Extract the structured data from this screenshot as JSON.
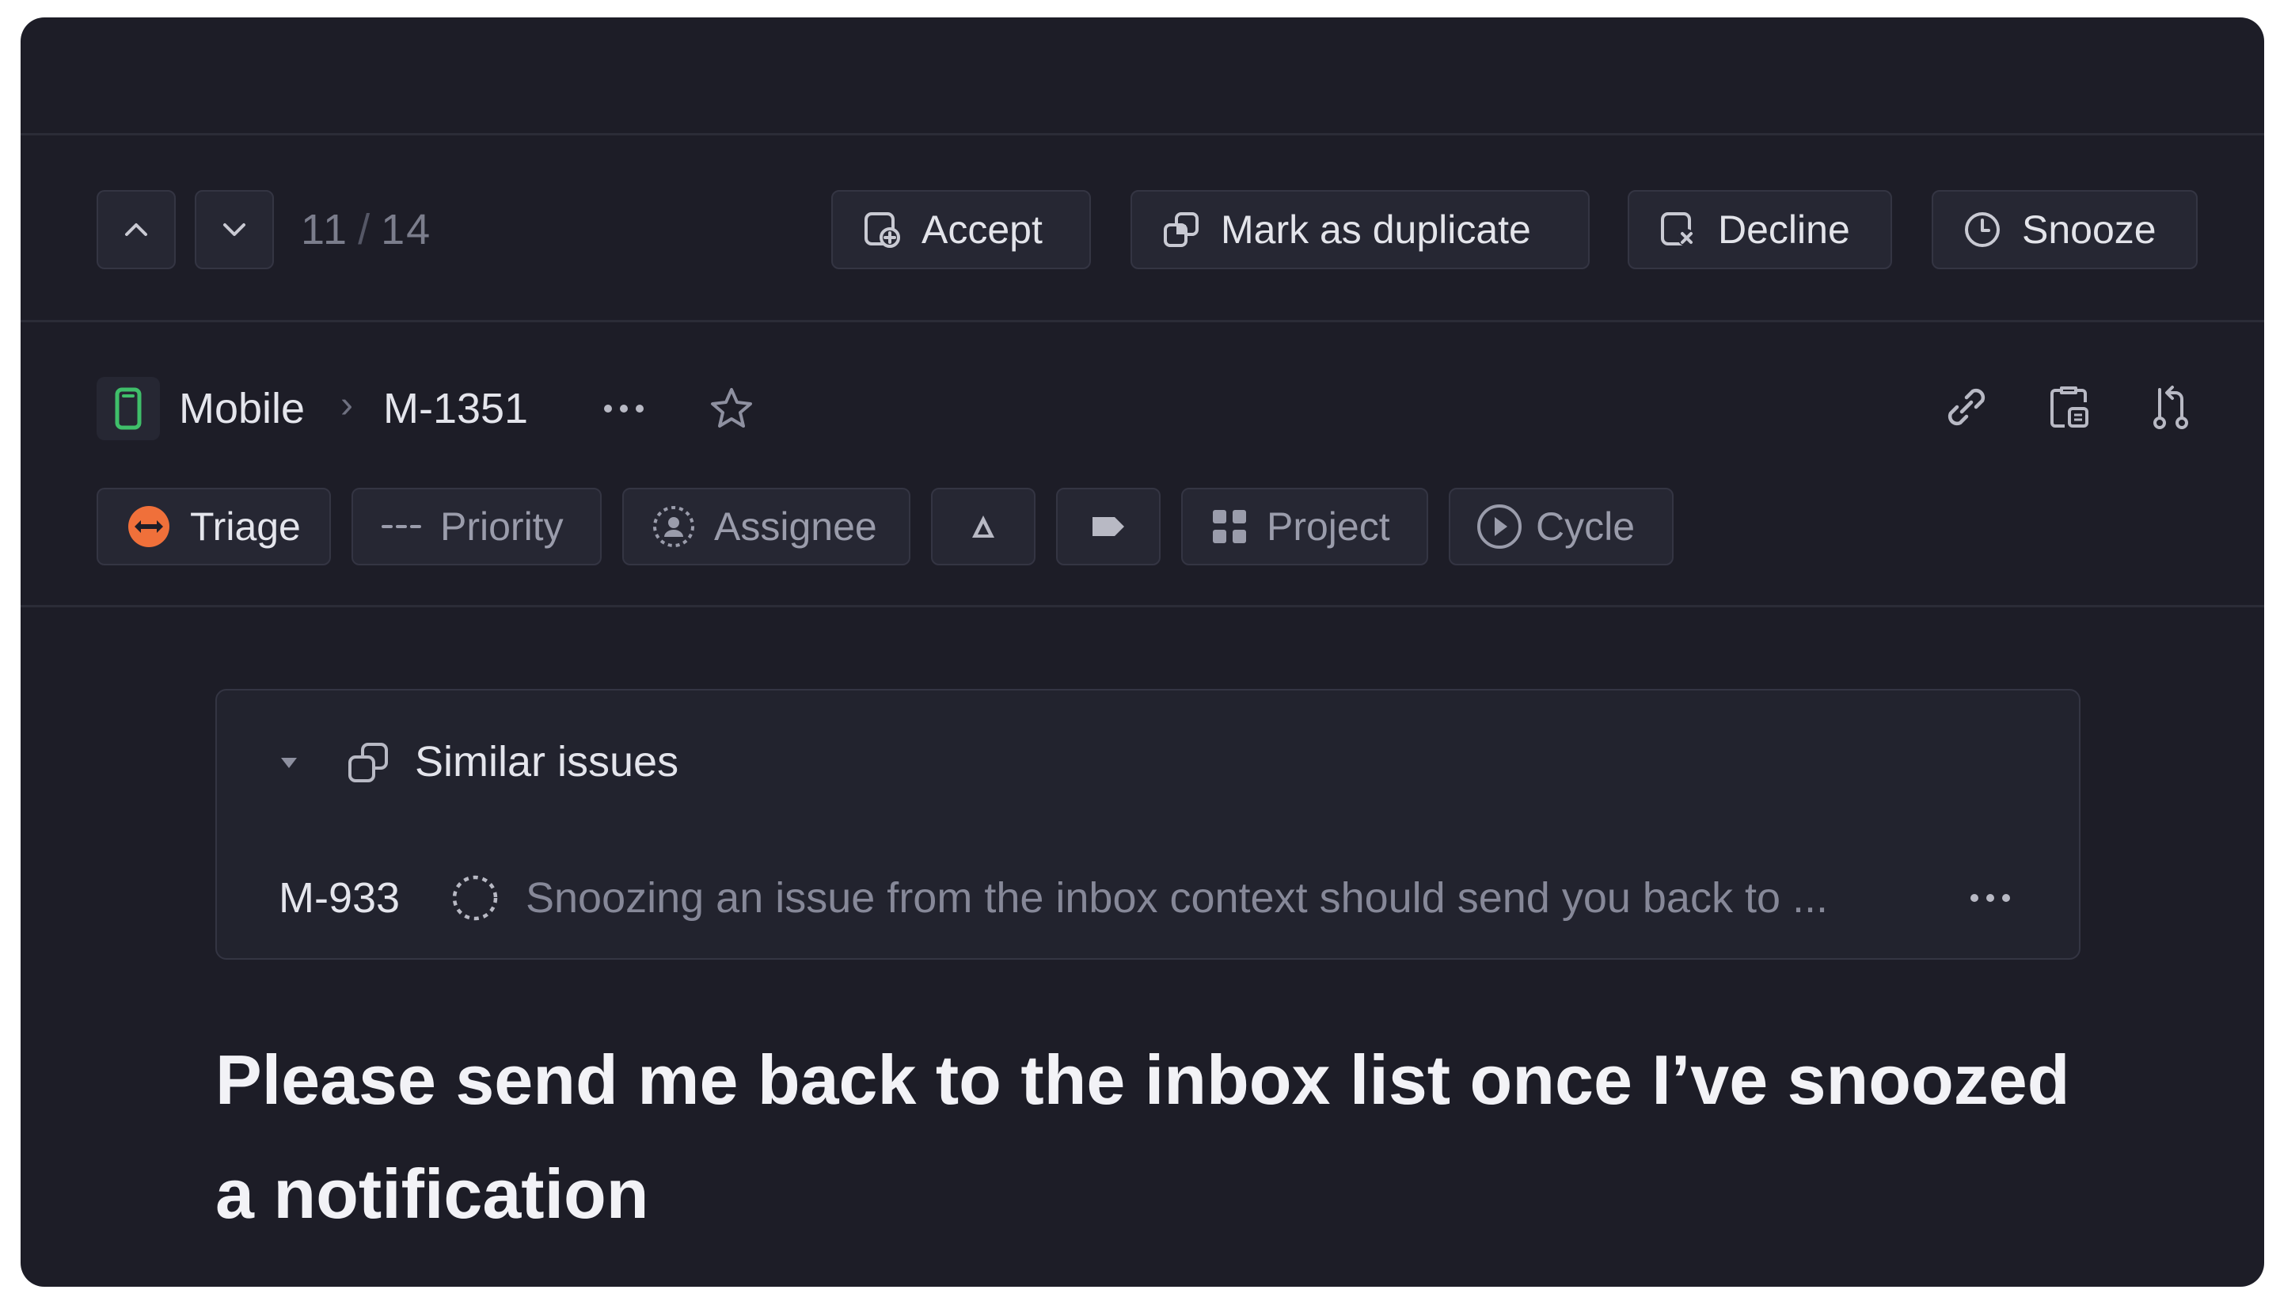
{
  "navigation": {
    "counter_current": "11",
    "counter_separator": "/",
    "counter_total": "14",
    "up_icon": "chevron-up-icon",
    "down_icon": "chevron-down-icon"
  },
  "actions": {
    "accept": {
      "label": "Accept",
      "icon": "accept-icon"
    },
    "duplicate": {
      "label": "Mark as duplicate",
      "icon": "duplicate-icon"
    },
    "decline": {
      "label": "Decline",
      "icon": "decline-icon"
    },
    "snooze": {
      "label": "Snooze",
      "icon": "clock-icon"
    }
  },
  "breadcrumb": {
    "team": "Mobile",
    "team_icon": "mobile-device-icon",
    "separator": "›",
    "issue_id": "M-1351",
    "more_icon": "more-dots-icon",
    "favorite_icon": "star-icon",
    "right_icons": [
      "link-icon",
      "clipboard-icon",
      "branch-icon"
    ]
  },
  "properties": {
    "status": {
      "label": "Triage",
      "icon": "triage-icon",
      "color": "#f0703a"
    },
    "priority": {
      "label": "Priority",
      "icon": "priority-dashes-icon"
    },
    "assignee": {
      "label": "Assignee",
      "icon": "assignee-icon"
    },
    "estimate": {
      "icon": "estimate-icon"
    },
    "labels": {
      "icon": "label-tag-icon"
    },
    "project": {
      "label": "Project",
      "icon": "project-grid-icon"
    },
    "cycle": {
      "label": "Cycle",
      "icon": "cycle-play-icon"
    }
  },
  "similar_issues": {
    "title": "Similar issues",
    "items": [
      {
        "id": "M-933",
        "status_icon": "backlog-status-icon",
        "title": "Snoozing an issue from the inbox context should send you back to ..."
      }
    ]
  },
  "issue": {
    "title": "Please send me back to the inbox list once I’ve snoozed a notification"
  },
  "colors": {
    "background": "#1d1d27",
    "button": "#262733",
    "border": "#343543",
    "text": "#e4e5ec",
    "muted": "#868898",
    "accent_orange": "#f0703a",
    "mobile_green": "#3fbf6a"
  }
}
